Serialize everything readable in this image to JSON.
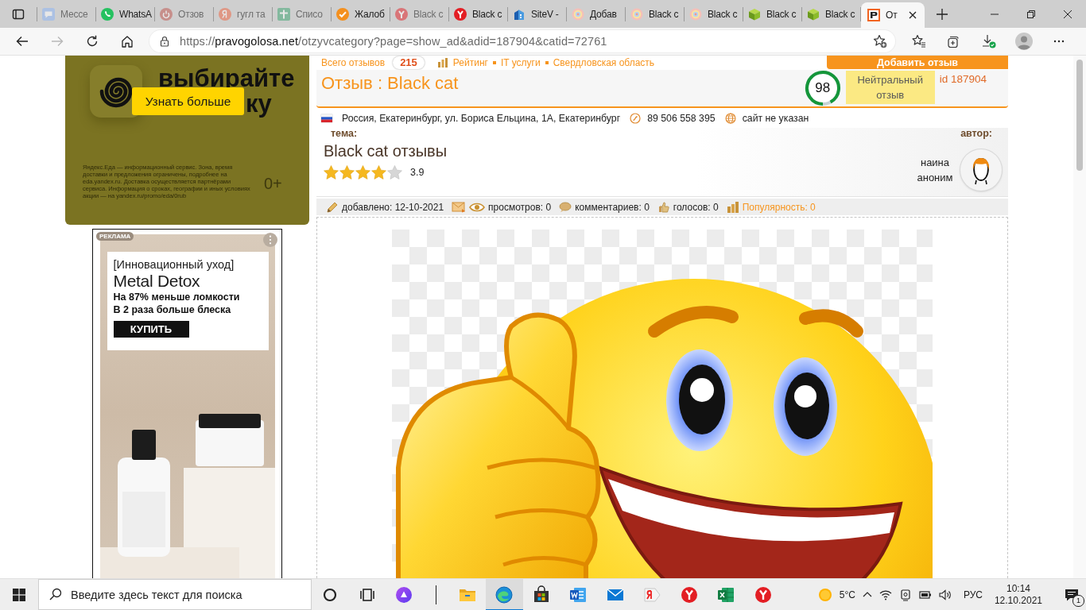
{
  "browser": {
    "tabs": [
      {
        "kind": "chat",
        "title": "Мессе",
        "sleeping": true,
        "selected": false
      },
      {
        "kind": "phone",
        "title": "WhatsA",
        "sleeping": false,
        "selected": false
      },
      {
        "kind": "power",
        "title": "Отзов",
        "sleeping": true,
        "selected": false
      },
      {
        "kind": "round",
        "title": "гугл та",
        "sleeping": true,
        "selected": false
      },
      {
        "kind": "cross",
        "title": "Списо",
        "sleeping": true,
        "selected": false
      },
      {
        "kind": "check",
        "title": "Жалоб",
        "sleeping": false,
        "selected": false
      },
      {
        "kind": "fork",
        "title": "Black c",
        "sleeping": true,
        "selected": false
      },
      {
        "kind": "fork",
        "title": "Black c",
        "sleeping": false,
        "selected": false
      },
      {
        "kind": "building",
        "title": "SiteV -",
        "sleeping": false,
        "selected": false
      },
      {
        "kind": "swirl",
        "title": "Добав",
        "sleeping": false,
        "selected": false
      },
      {
        "kind": "swirl",
        "title": "Black c",
        "sleeping": false,
        "selected": false
      },
      {
        "kind": "swirl",
        "title": "Black c",
        "sleeping": false,
        "selected": false
      },
      {
        "kind": "cube",
        "title": "Black c",
        "sleeping": false,
        "selected": false
      },
      {
        "kind": "cube",
        "title": "Black c",
        "sleeping": false,
        "selected": false
      },
      {
        "kind": "logo",
        "title": "От",
        "sleeping": false,
        "selected": true
      }
    ],
    "forward_disabled": true,
    "address": {
      "scheme": "https://",
      "host": "pravogolosa.net",
      "path": "/otzyvcategory?page=show_ad&adid=187904&catid=72761"
    }
  },
  "ads": {
    "eda": {
      "headline": "выбирайте",
      "headline_rest": "ку",
      "button": "Узнать больше",
      "disclaimer": "Яндекс.Еда — информационный сервис. Зона, время доставки и предложения ограничены, подробнее на eda.yandex.ru. Доставка осуществляется партнёрами сервиса. Информация о сроках, географии и иных условиях акции — на yandex.ru/promo/eda/0rub",
      "age": "0+"
    },
    "banner": {
      "badge": "РЕКЛАМА",
      "tagline": "[Инновационный уход]",
      "product": "Metal Detox",
      "claims": [
        "На 87% меньше ломкости",
        "В 2 раза больше блеска"
      ],
      "button": "КУПИТЬ"
    }
  },
  "review": {
    "total_label": "Всего отзывов",
    "total_count": "215",
    "links": [
      {
        "kind": "rating",
        "label": "Рейтинг"
      },
      {
        "kind": "category",
        "label": "IT услуги"
      },
      {
        "kind": "region",
        "label": "Свердловская область"
      }
    ],
    "add_button": "Добавить отзыв",
    "title": "Отзыв : Black cat",
    "score": "98",
    "score_meter": {
      "level": 0.92
    },
    "verdict": "Нейтральный отзыв",
    "id": "id 187904",
    "address": "Россия, Екатеринбург, ул. Бориса Ельцина, 1А, Екатеринбург",
    "phone": "89 506 558 395",
    "website": "сайт не указан",
    "topic_label": "тема:",
    "topic": "Black cat отзывы",
    "stars": 4,
    "rating": "3.9",
    "author_label": "автор:",
    "author": "наина аноним",
    "added": "добавлено: 12-10-2021",
    "views": "просмотров: 0",
    "comments": "комментариев: 0",
    "votes": "голосов: 0",
    "popularity": "Популярность: 0"
  },
  "taskbar": {
    "search_placeholder": "Введите здесь текст для поиска",
    "buttons": [
      {
        "kind": "ring"
      },
      {
        "kind": "taskview"
      },
      {
        "kind": "assistant"
      }
    ],
    "apps": [
      {
        "kind": "folder",
        "active": false
      },
      {
        "kind": "swirl",
        "active": true
      },
      {
        "kind": "bag",
        "active": false
      },
      {
        "kind": "document",
        "active": false
      },
      {
        "kind": "mail",
        "active": false
      },
      {
        "kind": "tag",
        "active": false
      },
      {
        "kind": "fork",
        "active": false
      },
      {
        "kind": "sheet",
        "active": false
      },
      {
        "kind": "fork",
        "active": false
      }
    ],
    "weather": "5°C",
    "language": "РУС",
    "time": "10:14",
    "date": "12.10.2021",
    "notifications": "1"
  }
}
